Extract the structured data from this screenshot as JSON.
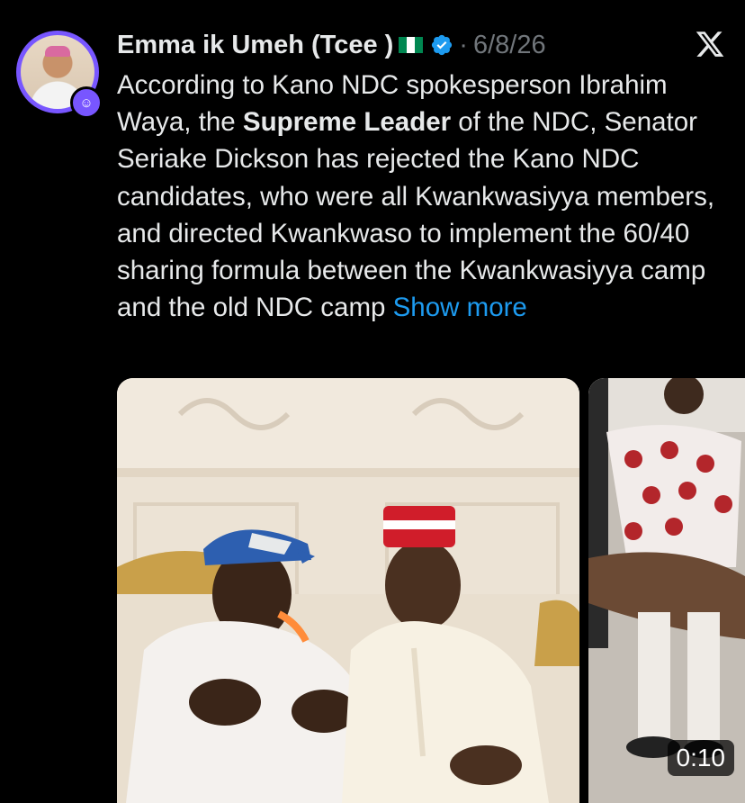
{
  "author": {
    "display_name": "Emma ik Umeh (Tcee )",
    "date": "6/8/26",
    "dot": "·"
  },
  "tweet": {
    "text_before_bold": "According to Kano NDC spokesperson Ibrahim Waya, the ",
    "bold": "Supreme Leader",
    "text_after_bold": " of the NDC, Senator Seriake Dickson has rejected the Kano NDC candidates, who were all Kwankwasiyya members, and directed Kwankwaso to implement the 60/40 sharing formula between the Kwankwasiyya camp and the old NDC camp ",
    "show_more": "Show more"
  },
  "media": {
    "video_duration": "0:10"
  },
  "colors": {
    "background": "#000000",
    "text": "#e7e9ea",
    "muted": "#71767b",
    "link": "#1d9bf0",
    "avatar_ring": "#7856ff",
    "verified": "#1d9bf0"
  },
  "icons": {
    "verified": "verified-badge-icon",
    "flag": "nigeria-flag-icon",
    "close": "x-logo-icon",
    "avatar_badge": "subscriber-badge-icon"
  }
}
